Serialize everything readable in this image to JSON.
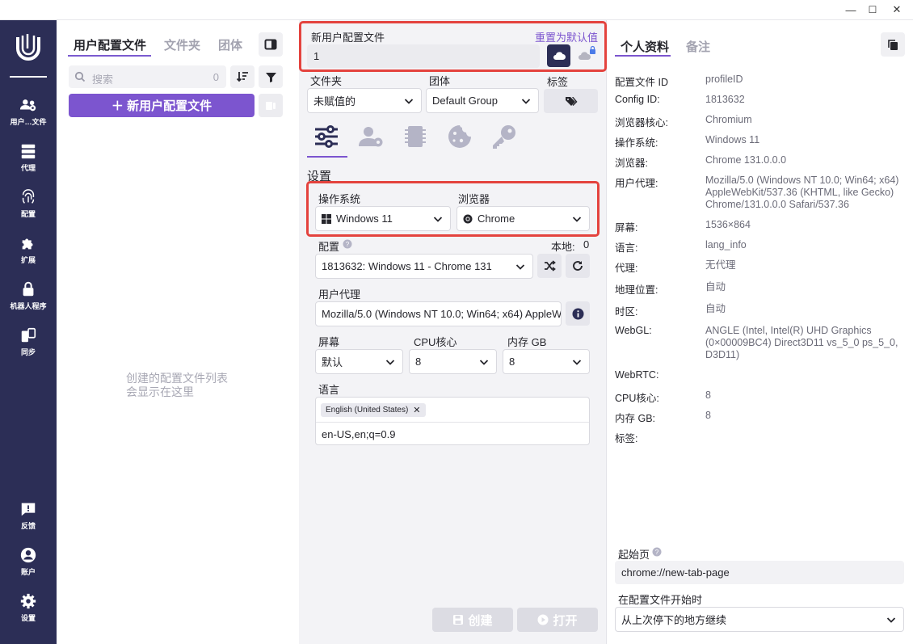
{
  "window": {
    "min_label": "—",
    "max_label": "☐",
    "close_label": "✕"
  },
  "nav": {
    "items": [
      {
        "label": "用户…文件",
        "icon": "users-gear-icon"
      },
      {
        "label": "代理",
        "icon": "server-icon"
      },
      {
        "label": "配置",
        "icon": "fingerprint-icon"
      },
      {
        "label": "扩展",
        "icon": "puzzle-icon"
      },
      {
        "label": "机器人程序",
        "icon": "lock-icon"
      },
      {
        "label": "同步",
        "icon": "sync-icon"
      },
      {
        "label": "反馈",
        "icon": "feedback-icon"
      },
      {
        "label": "账户",
        "icon": "account-icon"
      },
      {
        "label": "设置",
        "icon": "gear-icon"
      }
    ]
  },
  "profiles_panel": {
    "tabs": [
      "用户配置文件",
      "文件夹",
      "团体"
    ],
    "search_placeholder": "搜索",
    "search_count": "0",
    "new_button": "＋ 新用户配置文件",
    "empty_line1": "创建的配置文件列表",
    "empty_line2": "会显示在这里"
  },
  "form": {
    "name_label": "新用户配置文件",
    "reset_label": "重置为默认值",
    "name_value": "1",
    "folder_label": "文件夹",
    "folder_value": "未赋值的",
    "group_label": "团体",
    "group_value": "Default Group",
    "tag_label": "标签",
    "settings_label": "设置",
    "os_label": "操作系统",
    "os_value": "Windows 11",
    "browser_label": "浏览器",
    "browser_value": "Chrome",
    "config_label": "配置",
    "local_label": "本地:",
    "local_value": "0",
    "config_value": "1813632: Windows 11 - Chrome 131",
    "ua_label": "用户代理",
    "ua_value": "Mozilla/5.0 (Windows NT 10.0; Win64; x64) AppleWe",
    "screen_label": "屏幕",
    "screen_value": "默认",
    "cpu_label": "CPU核心",
    "cpu_value": "8",
    "mem_label": "内存 GB",
    "mem_value": "8",
    "lang_label": "语言",
    "lang_chip": "English (United States)",
    "lang_value": "en-US,en;q=0.9",
    "create_button": "创建",
    "open_button": "打开"
  },
  "details": {
    "tabs": [
      "个人资料",
      "备注"
    ],
    "rows": [
      {
        "k": "配置文件 ID",
        "v": "profileID"
      },
      {
        "k": "Config ID:",
        "v": "1813632"
      },
      {
        "k": "浏览器核心:",
        "v": "Chromium"
      },
      {
        "k": "操作系统:",
        "v": "Windows 11"
      },
      {
        "k": "浏览器:",
        "v": "Chrome 131.0.0.0"
      },
      {
        "k": "用户代理:",
        "v": "Mozilla/5.0 (Windows NT 10.0; Win64; x64) AppleWebKit/537.36 (KHTML, like Gecko) Chrome/131.0.0.0 Safari/537.36"
      },
      {
        "k": "屏幕:",
        "v": "1536×864"
      },
      {
        "k": "语言:",
        "v": "lang_info"
      },
      {
        "k": "代理:",
        "v": "无代理"
      },
      {
        "k": "地理位置:",
        "v": "自动"
      },
      {
        "k": "时区:",
        "v": "自动"
      },
      {
        "k": "WebGL:",
        "v": "ANGLE (Intel, Intel(R) UHD Graphics (0×00009BC4) Direct3D11 vs_5_0 ps_5_0, D3D11)"
      },
      {
        "k": "WebRTC:",
        "v": ""
      },
      {
        "k": "CPU核心:",
        "v": "8"
      },
      {
        "k": "内存 GB:",
        "v": "8"
      },
      {
        "k": "标签:",
        "v": ""
      }
    ],
    "start_page_label": "起始页",
    "start_page_value": "chrome://new-tab-page",
    "on_start_label": "在配置文件开始时",
    "on_start_value": "从上次停下的地方继续"
  },
  "colors": {
    "nav_bg": "#2c2e56",
    "accent": "#7c55cf",
    "highlight": "#e4433e"
  }
}
